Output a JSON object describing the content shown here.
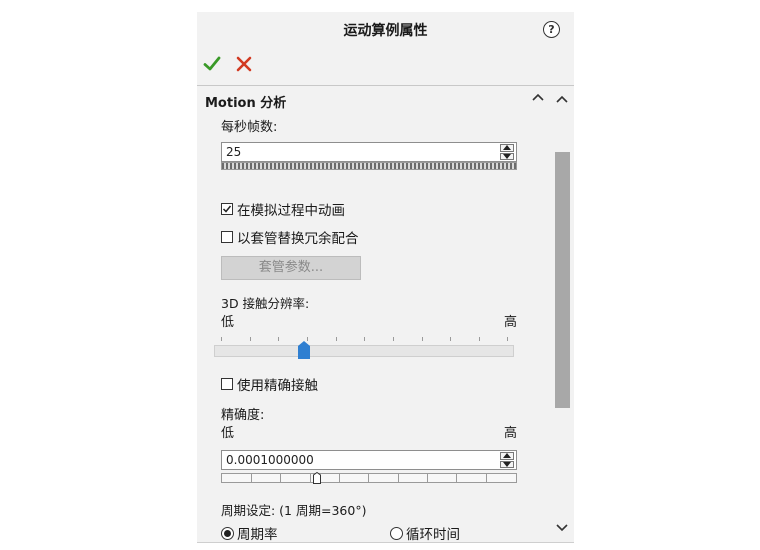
{
  "panel": {
    "title": "运动算例属性",
    "help_glyph": "?",
    "ok_icon": "checkmark-icon",
    "cancel_icon": "close-icon"
  },
  "section": {
    "title": "Motion 分析",
    "fps_label": "每秒帧数:",
    "fps_value": "25",
    "animate_label": "在模拟过程中动画",
    "animate_checked": true,
    "bushing_label": "以套管替换冗余配合",
    "bushing_checked": false,
    "bushing_params_button": "套管参数...",
    "contact_resolution_label": "3D 接触分辨率:",
    "low_label": "低",
    "high_label": "高",
    "precise_contact_label": "使用精确接触",
    "precise_contact_checked": false,
    "accuracy_label": "精确度:",
    "accuracy_low": "低",
    "accuracy_high": "高",
    "accuracy_value": "0.0001000000",
    "period_label": "周期设定: (1 周期=360°)",
    "period_rate_label": "周期率",
    "cycle_time_label": "循环时间",
    "period_rate_selected": true
  },
  "colors": {
    "ok": "#3a9a28",
    "cancel": "#d23a22",
    "thumb": "#2f7fd1",
    "scroll_thumb": "#a8a8a8"
  }
}
